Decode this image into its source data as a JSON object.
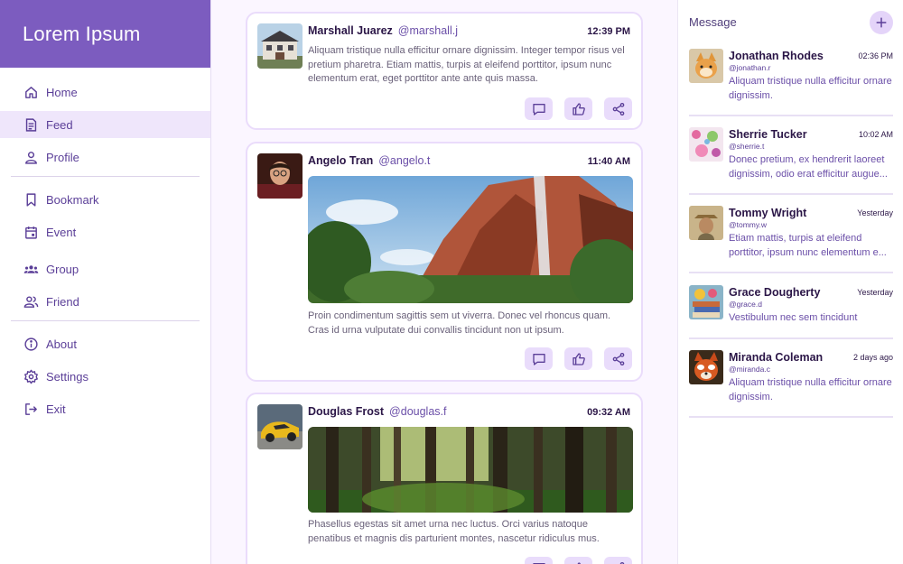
{
  "app": {
    "title": "Lorem Ipsum"
  },
  "nav": {
    "home": "Home",
    "feed": "Feed",
    "profile": "Profile",
    "bookmark": "Bookmark",
    "event": "Event",
    "group": "Group",
    "friend": "Friend",
    "about": "About",
    "settings": "Settings",
    "exit": "Exit",
    "active": "Feed"
  },
  "posts": [
    {
      "name": "Marshall Juarez",
      "handle": "@marshall.j",
      "time": "12:39 PM",
      "text": "Aliquam tristique nulla efficitur ornare dignissim. Integer tempor risus vel pretium pharetra. Etiam mattis, turpis at eleifend porttitor, ipsum nunc elementum erat, eget porttitor ante ante quis massa.",
      "avatar_icon": "house-photo"
    },
    {
      "name": "Angelo Tran",
      "handle": "@angelo.t",
      "time": "11:40 AM",
      "text": "Proin condimentum sagittis sem ut viverra. Donec vel rhoncus quam. Cras id urna vulputate dui convallis tincidunt non ut ipsum.",
      "avatar_icon": "portrait-photo",
      "image_icon": "canyon-waterfall-photo"
    },
    {
      "name": "Douglas Frost",
      "handle": "@douglas.f",
      "time": "09:32 AM",
      "text": "Phasellus egestas sit amet urna nec luctus. Orci varius natoque penatibus et magnis dis parturient montes, nascetur ridiculus mus.",
      "avatar_icon": "sports-car-photo",
      "image_icon": "forest-photo"
    }
  ],
  "messages": {
    "title": "Message",
    "items": [
      {
        "name": "Jonathan Rhodes",
        "handle": "@jonathan.r",
        "time": "02:36 PM",
        "text": "Aliquam tristique nulla efficitur ornare dignissim."
      },
      {
        "name": "Sherrie Tucker",
        "handle": "@sherrie.t",
        "time": "10:02 AM",
        "text": "Donec pretium, ex hendrerit laoreet dignissim, odio erat efficitur augue..."
      },
      {
        "name": "Tommy Wright",
        "handle": "@tommy.w",
        "time": "Yesterday",
        "text": "Etiam mattis, turpis at eleifend porttitor, ipsum nunc elementum e..."
      },
      {
        "name": "Grace Dougherty",
        "handle": "@grace.d",
        "time": "Yesterday",
        "text": "Vestibulum nec sem tincidunt"
      },
      {
        "name": "Miranda Coleman",
        "handle": "@miranda.c",
        "time": "2 days ago",
        "text": "Aliquam tristique nulla efficitur ornare dignissim."
      }
    ]
  },
  "colors": {
    "accent": "#7c5cbf",
    "accent_light": "#e9dcfb",
    "feed_bg": "#fbf6ff"
  }
}
